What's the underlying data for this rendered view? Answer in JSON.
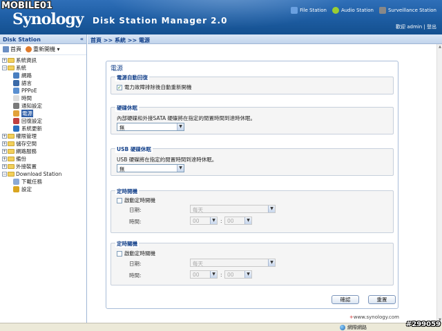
{
  "watermark": "MOBILE01",
  "header": {
    "logo": "Synology",
    "title": "Disk Station Manager 2.0",
    "links": [
      {
        "label": "File Station",
        "icon": "file-station-icon",
        "color": "#6aa0e0"
      },
      {
        "label": "Audio Station",
        "icon": "audio-station-icon",
        "color": "#9acd32"
      },
      {
        "label": "Surveillance Station",
        "icon": "surveillance-icon",
        "color": "#888888"
      }
    ],
    "user_line": "歡迎 admin | 登出"
  },
  "sidebar": {
    "title": "Disk Station",
    "collapse": "«",
    "toolbar": {
      "home": "首頁",
      "restart": "重新開機 ▾"
    },
    "tree": [
      {
        "label": "系統資訊",
        "level": 0,
        "type": "folder",
        "expanded": false
      },
      {
        "label": "系統",
        "level": 0,
        "type": "folder",
        "expanded": true
      },
      {
        "label": "網路",
        "level": 1,
        "type": "leaf",
        "color": "#4a7fc0"
      },
      {
        "label": "語言",
        "level": 1,
        "type": "leaf",
        "color": "#3b6aa8"
      },
      {
        "label": "PPPoE",
        "level": 1,
        "type": "leaf",
        "color": "#5a8fd0"
      },
      {
        "label": "時間",
        "level": 1,
        "type": "leaf",
        "color": "#dddddd"
      },
      {
        "label": "通知設定",
        "level": 1,
        "type": "leaf",
        "color": "#7a7a7a"
      },
      {
        "label": "電源",
        "level": 1,
        "type": "leaf",
        "color": "#e2a23a",
        "selected": true
      },
      {
        "label": "回復設定",
        "level": 1,
        "type": "leaf",
        "color": "#c04040"
      },
      {
        "label": "系統更新",
        "level": 1,
        "type": "leaf",
        "color": "#2a70c0"
      },
      {
        "label": "權限管理",
        "level": 0,
        "type": "folder",
        "expanded": false
      },
      {
        "label": "儲存空間",
        "level": 0,
        "type": "folder",
        "expanded": false
      },
      {
        "label": "網路服務",
        "level": 0,
        "type": "folder",
        "expanded": false
      },
      {
        "label": "備份",
        "level": 0,
        "type": "folder",
        "expanded": false
      },
      {
        "label": "外接裝置",
        "level": 0,
        "type": "folder",
        "expanded": false
      },
      {
        "label": "Download Station",
        "level": 0,
        "type": "folder",
        "expanded": true
      },
      {
        "label": "下載任務",
        "level": 1,
        "type": "leaf",
        "color": "#8aa9d6"
      },
      {
        "label": "設定",
        "level": 1,
        "type": "leaf",
        "color": "#d9a520"
      }
    ]
  },
  "breadcrumb": "首頁 >> 系統 >> 電源",
  "panel": {
    "title": "電源",
    "auto_restart": {
      "legend": "電源自動回復",
      "checkbox_label": "電力故障排除後自動重新開機",
      "checked": true
    },
    "hdd_hibernation": {
      "legend": "硬碟休眠",
      "description": "內部硬碟和外接SATA 硬碟將在指定的閒置時間到達時休眠。",
      "value": "無"
    },
    "usb_hibernation": {
      "legend": "USB 硬碟休眠",
      "description": "USB 硬碟將在指定的閒置時間到達時休眠。",
      "value": "無"
    },
    "power_on": {
      "legend": "定時開機",
      "checkbox_label": "啟動定時開機",
      "checked": false,
      "date_label": "日期:",
      "date_value": "每天",
      "time_label": "時間:",
      "hour": "00",
      "minute": "00",
      "colon": ":"
    },
    "power_off": {
      "legend": "定時關機",
      "checkbox_label": "啟動定時關機",
      "checked": false,
      "date_label": "日期:",
      "date_value": "每天",
      "time_label": "時間:",
      "hour": "00",
      "minute": "00",
      "colon": ":"
    },
    "buttons": {
      "ok": "確認",
      "reset": "重置"
    }
  },
  "footer": {
    "plus": "+",
    "link": "www.synology.com"
  },
  "statusbar": {
    "zone": "網際網路"
  },
  "image_id": "#299059"
}
